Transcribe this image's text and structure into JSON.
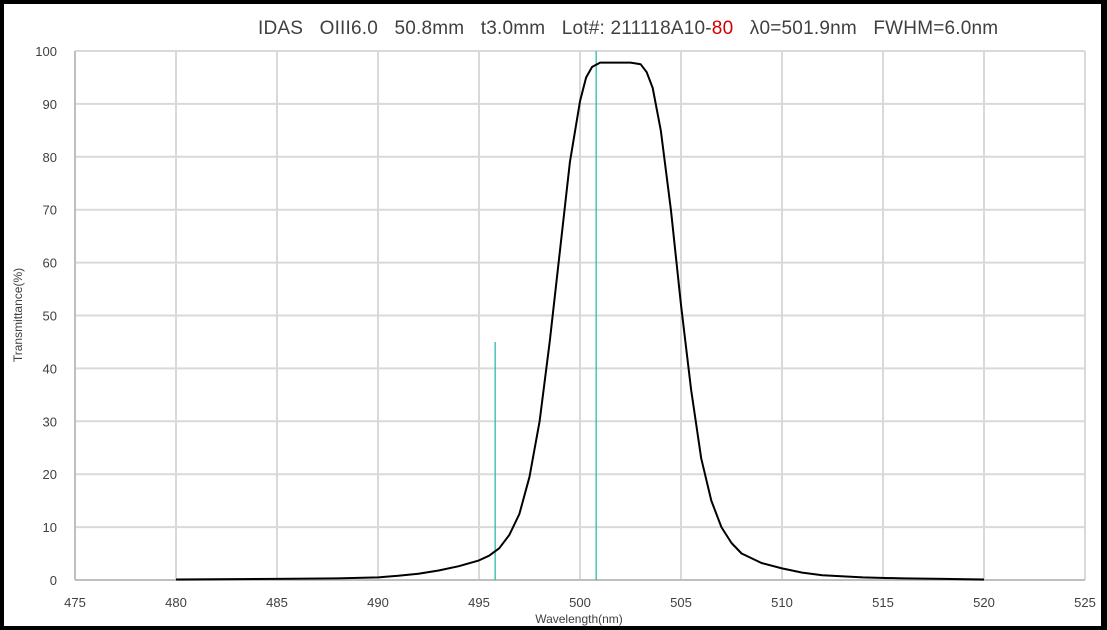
{
  "chart_data": {
    "type": "line",
    "title": {
      "brand": "IDAS",
      "model": "OIII6.0",
      "size": "50.8mm",
      "thickness": "t3.0mm",
      "lot_prefix": "Lot#:",
      "lot_number": "211118A10-",
      "lot_highlight": "80",
      "center": "λ0=501.9nm",
      "fwhm": "FWHM=6.0nm"
    },
    "xlabel": "Wavelength(nm)",
    "ylabel": "Transmittance(%)",
    "xlim": [
      475,
      525
    ],
    "ylim": [
      0,
      100
    ],
    "xticks": [
      475,
      480,
      485,
      490,
      495,
      500,
      505,
      510,
      515,
      520,
      525
    ],
    "yticks": [
      0,
      10,
      20,
      30,
      40,
      50,
      60,
      70,
      80,
      90,
      100
    ],
    "grid": true,
    "colors": {
      "curve": "#000000",
      "markers": "#1fb5a5",
      "grid": "#d9d9d9",
      "highlight": "#d40000"
    },
    "series": [
      {
        "x": [
          480,
          485,
          488,
          490,
          491,
          492,
          493,
          494,
          495,
          495.5,
          496,
          496.5,
          497,
          497.5,
          498,
          498.5,
          499,
          499.5,
          500,
          500.3,
          500.6,
          501,
          501.5,
          502,
          502.5,
          503,
          503.3,
          503.6,
          504,
          504.5,
          505,
          505.5,
          506,
          506.5,
          507,
          507.5,
          508,
          509,
          510,
          511,
          512,
          514,
          516,
          518,
          520
        ],
        "y": [
          0.1,
          0.2,
          0.3,
          0.5,
          0.8,
          1.2,
          1.8,
          2.6,
          3.7,
          4.6,
          6.0,
          8.5,
          12.5,
          19.5,
          30.0,
          45.0,
          62.0,
          79.0,
          90.5,
          95.0,
          97.0,
          97.8,
          97.8,
          97.8,
          97.8,
          97.5,
          96.0,
          93.0,
          85.0,
          70.0,
          52.0,
          36.0,
          23.0,
          15.0,
          10.0,
          7.0,
          5.0,
          3.2,
          2.2,
          1.4,
          0.9,
          0.5,
          0.3,
          0.2,
          0.1
        ]
      }
    ],
    "markers": [
      {
        "x": 495.8,
        "y_top": 45
      },
      {
        "x": 500.8,
        "y_top": 100
      }
    ]
  }
}
